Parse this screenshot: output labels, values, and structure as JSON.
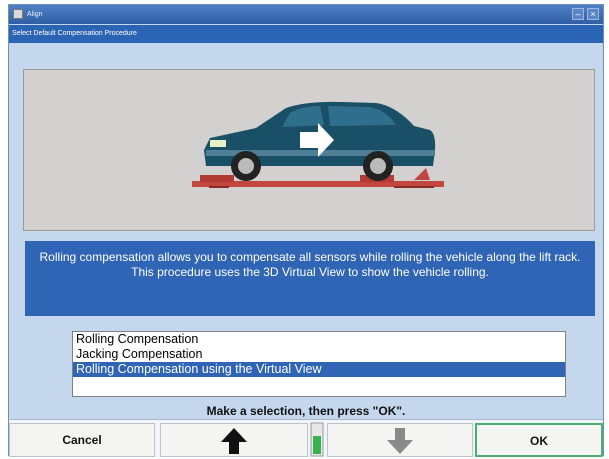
{
  "window": {
    "title": "Align"
  },
  "header": {
    "subtitle": "Select Default Compensation Procedure"
  },
  "description": "Rolling compensation allows you to compensate all sensors while rolling the vehicle along the lift rack.   This procedure uses the 3D Virtual View to show the vehicle rolling.",
  "options": [
    {
      "label": "Rolling Compensation",
      "selected": false
    },
    {
      "label": "Jacking Compensation",
      "selected": false
    },
    {
      "label": "Rolling Compensation using the Virtual View",
      "selected": true
    }
  ],
  "prompt": "Make a selection, then press \"OK\".",
  "footer": {
    "cancel_label": "Cancel",
    "ok_label": "OK",
    "up_icon": "arrow-up-icon",
    "down_icon": "arrow-down-icon",
    "up_enabled": true,
    "down_enabled": false
  },
  "colors": {
    "accent": "#2f65b4",
    "car_body": "#1a4f68",
    "rack": "#c2453f",
    "ok_border": "#4caf72"
  }
}
